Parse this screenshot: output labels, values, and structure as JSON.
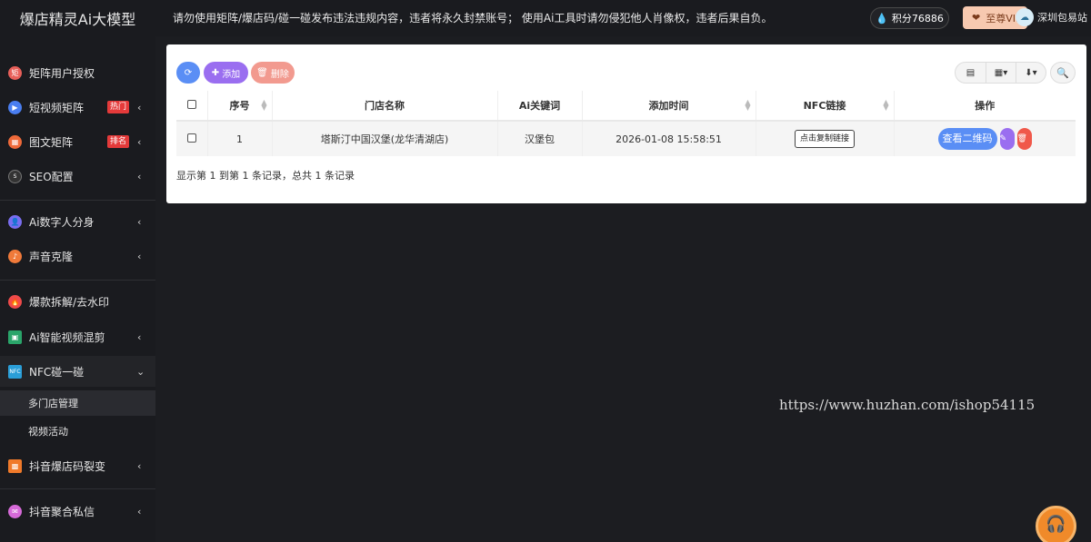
{
  "header": {
    "brand": "爆店精灵Ai大模型",
    "notice": "请勿使用矩阵/爆店码/碰一碰发布违法违规内容，违者将永久封禁账号； 使用Ai工具时请勿侵犯他人肖像权，违者后果自负。",
    "points": "积分76886",
    "vip": "至尊VIP",
    "city": "深圳包易站"
  },
  "sidebar": {
    "items": [
      {
        "label": "矩阵用户授权",
        "icon": "authorize-icon",
        "color": "#e8605a"
      },
      {
        "label": "短视频矩阵",
        "icon": "video-matrix-icon",
        "color": "#4a7ef0",
        "badge": "热门"
      },
      {
        "label": "图文矩阵",
        "icon": "image-text-icon",
        "color": "#ef6a3a",
        "badge": "排名"
      },
      {
        "label": "SEO配置",
        "icon": "seo-icon",
        "color": "#333333"
      },
      {
        "label": "Ai数字人分身",
        "icon": "digital-human-icon",
        "color": "#7a6ef0"
      },
      {
        "label": "声音克隆",
        "icon": "voice-clone-icon",
        "color": "#f07a3a"
      },
      {
        "label": "爆款拆解/去水印",
        "icon": "hot-icon",
        "color": "#ef4a4a"
      },
      {
        "label": "Ai智能视频混剪",
        "icon": "video-edit-icon",
        "color": "#2aa56a"
      },
      {
        "label": "NFC碰一碰",
        "icon": "nfc-icon",
        "color": "#2a9ed8"
      },
      {
        "label": "抖音爆店码裂变",
        "icon": "qrcode-icon",
        "color": "#f07a2a"
      },
      {
        "label": "抖音聚合私信",
        "icon": "message-icon",
        "color": "#d66ad8"
      }
    ],
    "sub_items": [
      "多门店管理",
      "视频活动"
    ]
  },
  "toolbar": {
    "add_label": "添加",
    "delete_label": "删除"
  },
  "table": {
    "headers": [
      "序号",
      "门店名称",
      "Ai关键词",
      "添加时间",
      "NFC链接",
      "操作"
    ],
    "rows": [
      {
        "index": "1",
        "store": "塔斯汀中国汉堡(龙华清湖店)",
        "keyword": "汉堡包",
        "time": "2026-01-08 15:58:51",
        "nfc": "点击复制链接",
        "action": "查看二维码"
      }
    ],
    "summary": "显示第 1 到第 1 条记录，总共 1 条记录"
  },
  "watermark": "https://www.huzhan.com/ishop54115",
  "colors": {
    "accent_blue": "#5a8ef5",
    "accent_purple": "#9a6ef0",
    "danger_red": "#f0584a"
  }
}
